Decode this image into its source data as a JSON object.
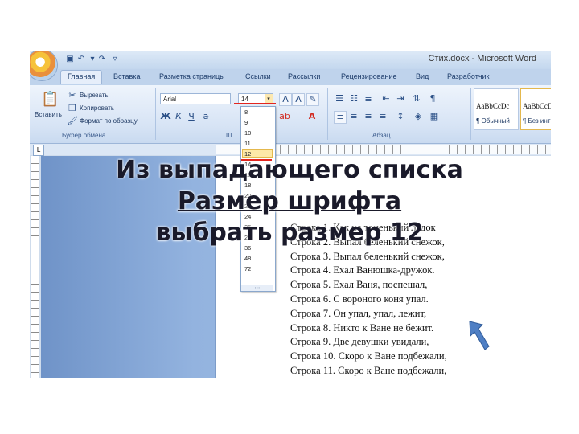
{
  "window": {
    "title": "Стих.docx - Microsoft Word"
  },
  "quick_access": {
    "icons": [
      "save-icon",
      "undo-icon",
      "redo-icon",
      "customize-icon"
    ]
  },
  "tabs": [
    {
      "label": "Главная",
      "active": true
    },
    {
      "label": "Вставка"
    },
    {
      "label": "Разметка страницы"
    },
    {
      "label": "Ссылки"
    },
    {
      "label": "Рассылки"
    },
    {
      "label": "Рецензирование"
    },
    {
      "label": "Вид"
    },
    {
      "label": "Разработчик"
    }
  ],
  "clipboard": {
    "paste_label": "Вставить",
    "cut_label": "Вырезать",
    "copy_label": "Копировать",
    "format_painter_label": "Формат по образцу",
    "group_label": "Буфер обмена"
  },
  "font": {
    "name": "Arial",
    "size": "14",
    "bold": "Ж",
    "italic": "К",
    "underline": "Ч",
    "group_label": "Ш"
  },
  "paragraph": {
    "group_label": "Абзац"
  },
  "styles": [
    {
      "sample": "АаBbCcDc",
      "name": "¶ Обычный"
    },
    {
      "sample": "АаBbCcDc",
      "name": "¶ Без инт"
    }
  ],
  "size_dropdown": {
    "options": [
      "8",
      "9",
      "10",
      "11",
      "12",
      "14",
      "16",
      "18",
      "20",
      "22",
      "24",
      "26",
      "28",
      "36",
      "48",
      "72"
    ],
    "highlighted": "12"
  },
  "document": {
    "lines": [
      "Строка 1. Как на тоненький ледок",
      "Строка 2. Выпал беленький снежок,",
      "Строка 3. Выпал беленький снежок,",
      "Строка 4. Ехал Ванюшка-дружок.",
      "Строка 5. Ехал Ваня, поспешал,",
      "Строка 6. С вороного коня упал.",
      "Строка 7. Он упал, упал, лежит,",
      "Строка 8. Никто к Ване не бежит.",
      "Строка 9. Две девушки увидали,",
      "Строка 10. Скоро к Ване подбежали,",
      "Строка 11. Скоро к Ване подбежали,"
    ]
  },
  "caption": {
    "line1": "Из выпадающего списка",
    "line2": "Размер шрифта",
    "line3": "выбрать размер 12"
  },
  "colors": {
    "arrow": "#4f7fc4",
    "highlight_mark": "#e3261f",
    "ribbon": "#d7e4f5"
  }
}
